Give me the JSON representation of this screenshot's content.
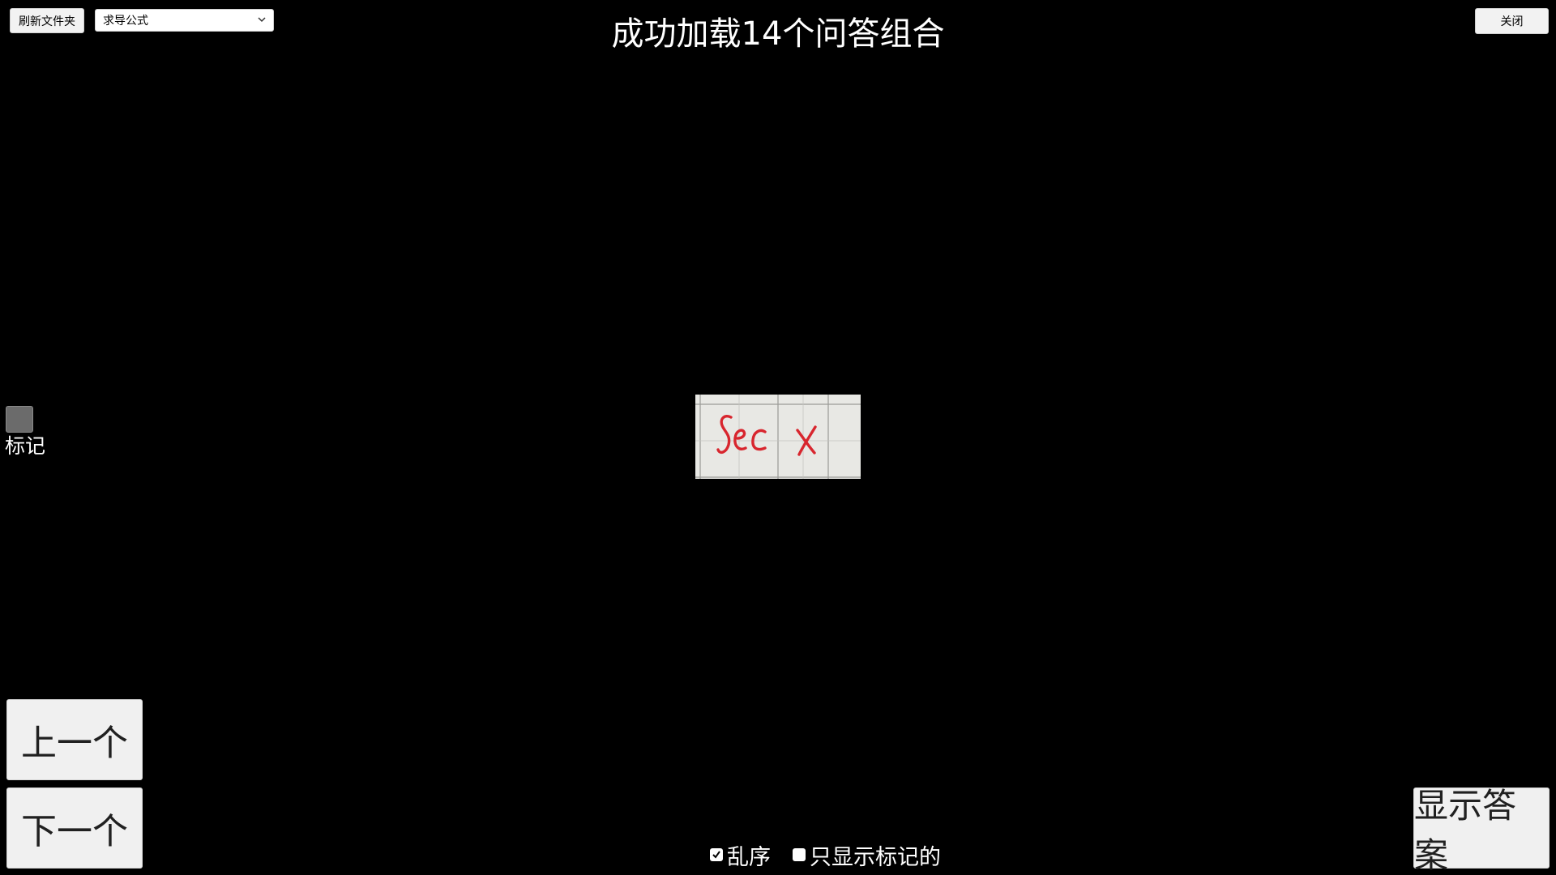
{
  "toolbar": {
    "refresh_label": "刷新文件夹",
    "category_selected": "求导公式",
    "close_label": "关闭"
  },
  "status_title": "成功加载14个问答组合",
  "mark": {
    "label": "标记",
    "checked": false
  },
  "card": {
    "handwritten_text": "sec x",
    "ink_color": "#d8262e",
    "paper_color": "#e8e8e4"
  },
  "navigation": {
    "prev_label": "上一个",
    "next_label": "下一个",
    "show_answer_label": "显示答案"
  },
  "options": {
    "shuffle_label": "乱序",
    "shuffle_checked": true,
    "only_marked_label": "只显示标记的",
    "only_marked_checked": false
  }
}
